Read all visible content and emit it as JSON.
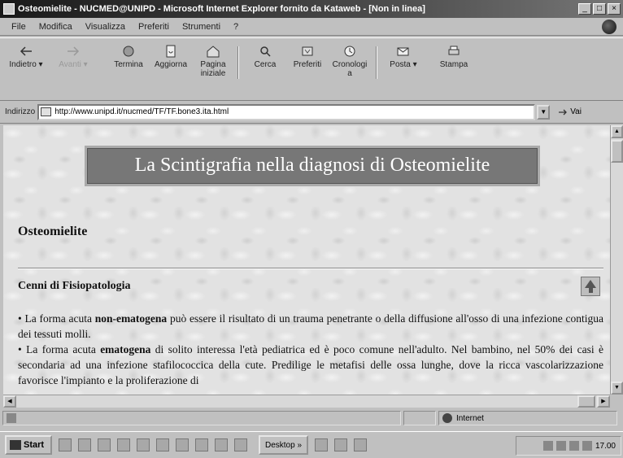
{
  "window": {
    "title": "Osteomielite - NUCMED@UNIPD - Microsoft Internet Explorer fornito da Kataweb - [Non in linea]"
  },
  "menu": [
    "File",
    "Modifica",
    "Visualizza",
    "Preferiti",
    "Strumenti",
    "?"
  ],
  "toolbar": {
    "back": "Indietro",
    "forward": "Avanti",
    "stop": "Termina",
    "refresh": "Aggiorna",
    "home_line1": "Pagina",
    "home_line2": "iniziale",
    "search": "Cerca",
    "favorites": "Preferiti",
    "history_line1": "Cronologi",
    "history_line2": "a",
    "mail": "Posta",
    "print": "Stampa"
  },
  "address": {
    "label": "Indirizzo",
    "url": "http://www.unipd.it/nucmed/TF/TF.bone3.ita.html",
    "go": "Vai"
  },
  "page": {
    "banner": "La Scintigrafia nella diagnosi di Osteomielite",
    "heading": "Osteomielite",
    "subheading": "Cenni di Fisiopatologia",
    "p1_pre": "La forma acuta ",
    "p1_bold": "non-ematogena",
    "p1_post": " può essere il risultato di un trauma penetrante o della diffusione all'osso di una infezione contigua dei tessuti molli.",
    "p2_pre": "La forma acuta ",
    "p2_bold": "ematogena",
    "p2_post": " di solito interessa l'età pediatrica ed è poco comune nell'adulto. Nel bambino, nel 50% dei casi è secondaria ad una infezione stafilococcica della cute. Predilige le metafisi delle ossa lunghe, dove la ricca vascolarizzazione favorisce l'impianto e la proliferazione di"
  },
  "status": {
    "zone": "Internet"
  },
  "taskbar": {
    "start": "Start",
    "desktop": "Desktop",
    "clock": "17.00"
  }
}
